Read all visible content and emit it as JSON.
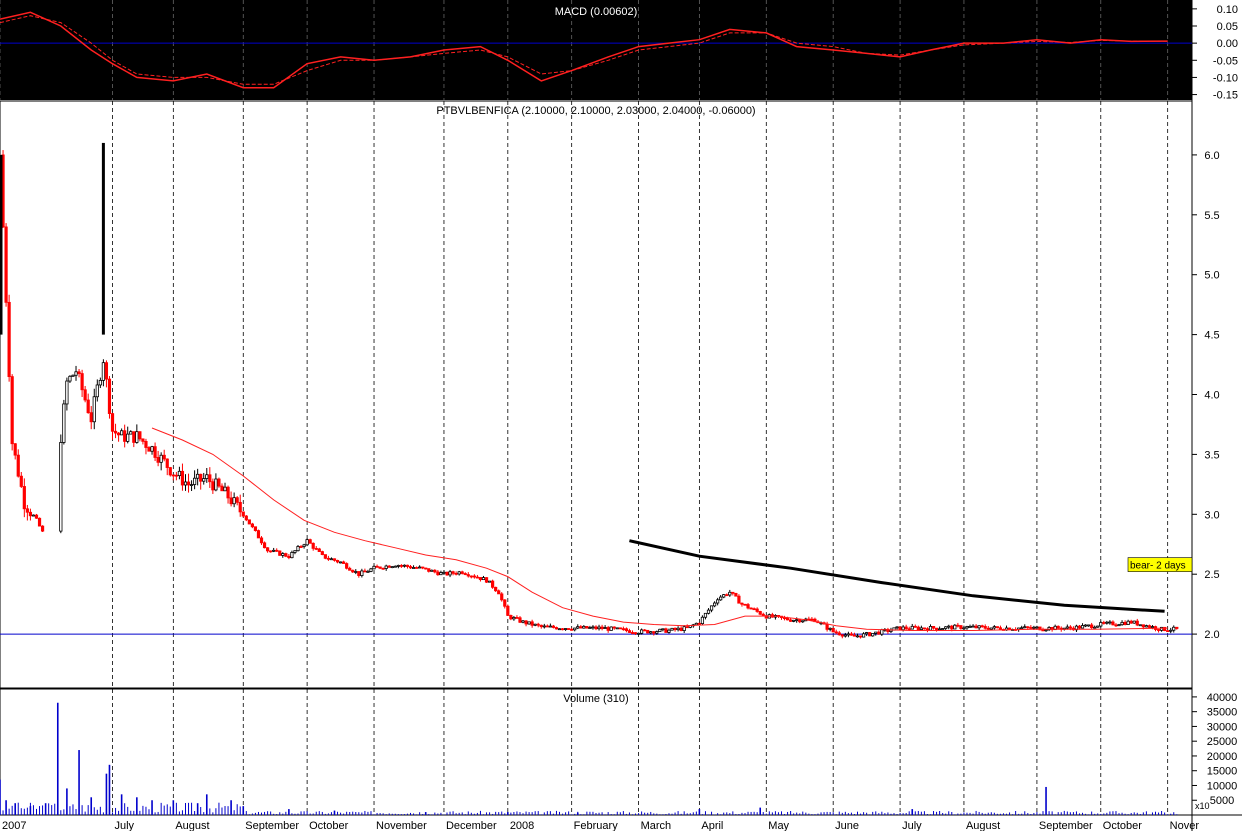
{
  "macd_panel": {
    "title": "MACD (0.00602)",
    "y_ticks": [
      "0.10",
      "0.05",
      "0.00",
      "-0.05",
      "-0.10",
      "-0.15"
    ],
    "y_tick_values": [
      0.1,
      0.05,
      0.0,
      -0.05,
      -0.1,
      -0.15
    ],
    "ylim": [
      -0.16,
      0.12
    ]
  },
  "price_panel": {
    "title": "PTBVLBENFICA (2.10000, 2.10000, 2.03000, 2.04000, -0.06000)",
    "y_ticks": [
      "6.0",
      "5.5",
      "5.0",
      "4.5",
      "4.0",
      "3.5",
      "3.0",
      "2.5",
      "2.0"
    ],
    "y_tick_values": [
      6.0,
      5.5,
      5.0,
      4.5,
      4.0,
      3.5,
      3.0,
      2.5,
      2.0
    ],
    "ylim": [
      1.55,
      6.45
    ],
    "annotation": "bear- 2 days",
    "reference_line": 2.0
  },
  "volume_panel": {
    "title": "Volume (310)",
    "y_ticks": [
      "40000",
      "35000",
      "30000",
      "25000",
      "20000",
      "15000",
      "10000",
      "5000"
    ],
    "y_tick_values": [
      40000,
      35000,
      30000,
      25000,
      20000,
      15000,
      10000,
      5000
    ],
    "ylim": [
      0,
      42000
    ],
    "multiplier_label": "x10"
  },
  "x_axis": {
    "labels": [
      "2007",
      "July",
      "August",
      "September",
      "October",
      "November",
      "December",
      "2008",
      "February",
      "March",
      "April",
      "May",
      "June",
      "July",
      "August",
      "September",
      "October",
      "Nover"
    ],
    "label_index": [
      0,
      37,
      57,
      80,
      101,
      123,
      146,
      167,
      188,
      210,
      230,
      252,
      274,
      296,
      317,
      341,
      362,
      384
    ]
  },
  "colors": {
    "macd_bg": "#000000",
    "macd_line": "#ff2020",
    "zero_line": "#0000cc",
    "bear_line": "#000000",
    "sma_line": "#ff2020",
    "up_bar": "#000000",
    "down_bar": "#ff0000",
    "volume_bar": "#0000cc",
    "annotation_bg": "#ffff00"
  },
  "chart_data": [
    {
      "type": "line",
      "title": "MACD (0.00602)",
      "x_index": [
        0,
        10,
        20,
        30,
        37,
        45,
        57,
        68,
        80,
        90,
        101,
        112,
        123,
        135,
        146,
        158,
        167,
        178,
        188,
        200,
        210,
        220,
        230,
        240,
        252,
        262,
        274,
        285,
        296,
        306,
        317,
        330,
        341,
        352,
        362,
        372,
        384
      ],
      "series": [
        {
          "name": "MACD",
          "values": [
            0.07,
            0.09,
            0.05,
            -0.02,
            -0.06,
            -0.1,
            -0.11,
            -0.09,
            -0.13,
            -0.13,
            -0.06,
            -0.04,
            -0.05,
            -0.04,
            -0.02,
            -0.01,
            -0.05,
            -0.11,
            -0.08,
            -0.04,
            -0.01,
            0.0,
            0.01,
            0.04,
            0.03,
            -0.01,
            -0.02,
            -0.03,
            -0.04,
            -0.02,
            0.0,
            0.0,
            0.01,
            0.0,
            0.01,
            0.005,
            0.006
          ]
        },
        {
          "name": "Signal",
          "values": [
            0.06,
            0.08,
            0.06,
            0.0,
            -0.05,
            -0.09,
            -0.1,
            -0.1,
            -0.12,
            -0.12,
            -0.08,
            -0.05,
            -0.05,
            -0.04,
            -0.03,
            -0.02,
            -0.04,
            -0.09,
            -0.08,
            -0.05,
            -0.02,
            -0.01,
            0.0,
            0.03,
            0.03,
            0.0,
            -0.01,
            -0.03,
            -0.035,
            -0.02,
            -0.005,
            0.0,
            0.005,
            0.002,
            0.008,
            0.006,
            0.006
          ]
        }
      ]
    },
    {
      "type": "line",
      "title": "PTBVLBENFICA (2.10000, 2.10000, 2.03000, 2.04000, -0.06000)",
      "x_index": [
        0,
        4,
        8,
        12,
        16,
        22,
        25,
        30,
        34,
        37,
        40,
        45,
        50,
        57,
        62,
        68,
        75,
        80,
        88,
        95,
        101,
        106,
        112,
        118,
        123,
        130,
        138,
        146,
        152,
        160,
        164,
        167,
        172,
        178,
        188,
        198,
        210,
        220,
        226,
        230,
        236,
        240,
        244,
        252,
        260,
        268,
        274,
        280,
        286,
        296,
        306,
        317,
        328,
        341,
        352,
        362,
        372,
        382
      ],
      "series": [
        {
          "name": "Close",
          "values": [
            6.0,
            3.6,
            3.1,
            2.95,
            2.75,
            4.1,
            4.2,
            3.8,
            4.3,
            3.7,
            3.65,
            3.65,
            3.55,
            3.35,
            3.25,
            3.3,
            3.15,
            3.0,
            2.7,
            2.65,
            2.78,
            2.65,
            2.6,
            2.5,
            2.55,
            2.58,
            2.55,
            2.5,
            2.52,
            2.45,
            2.35,
            2.15,
            2.1,
            2.06,
            2.05,
            2.05,
            2.02,
            2.03,
            2.05,
            2.1,
            2.3,
            2.35,
            2.25,
            2.15,
            2.12,
            2.12,
            2.02,
            1.98,
            2.0,
            2.05,
            2.05,
            2.06,
            2.05,
            2.05,
            2.05,
            2.08,
            2.1,
            2.04
          ]
        }
      ]
    },
    {
      "type": "bar",
      "title": "Volume (310)",
      "x_index": [
        0,
        2,
        5,
        10,
        15,
        19,
        22,
        26,
        30,
        35,
        36,
        40,
        45,
        50,
        57,
        65,
        68,
        76,
        80,
        95,
        110,
        140,
        167,
        190,
        230,
        250,
        300,
        344
      ],
      "values": [
        12000,
        5000,
        4000,
        3000,
        4000,
        38000,
        9000,
        22000,
        6000,
        14000,
        17000,
        7000,
        6000,
        5000,
        5000,
        4000,
        7000,
        5000,
        3000,
        2000,
        1500,
        1000,
        1000,
        800,
        2000,
        2500,
        2000,
        9500
      ]
    }
  ]
}
